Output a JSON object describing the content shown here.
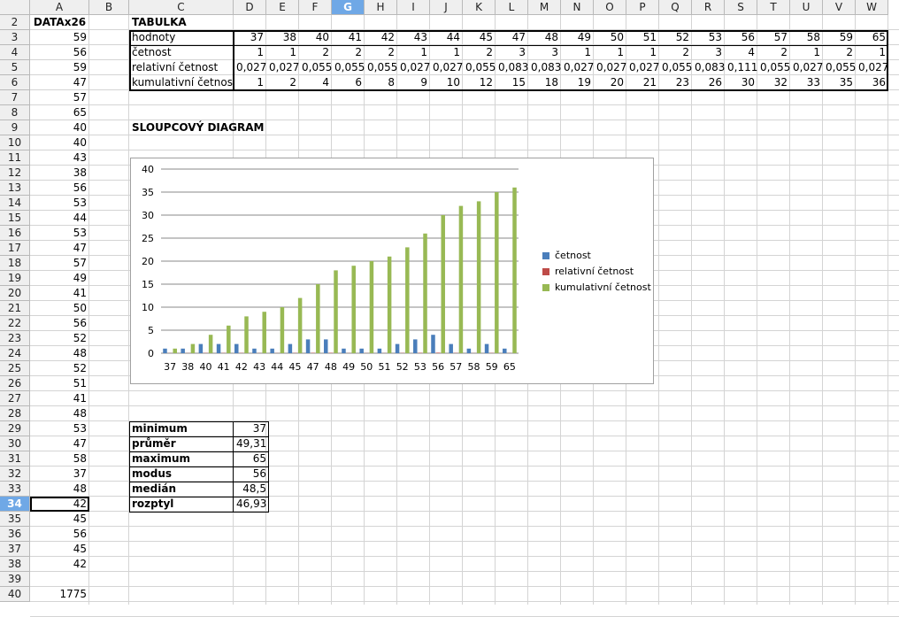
{
  "columns": [
    "A",
    "B",
    "C",
    "D",
    "E",
    "F",
    "G",
    "H",
    "I",
    "J",
    "K",
    "L",
    "M",
    "N",
    "O",
    "P",
    "Q",
    "R",
    "S",
    "T",
    "U",
    "V",
    "W"
  ],
  "selected_column": "G",
  "selected_row": 34,
  "rows": [
    2,
    3,
    4,
    5,
    6,
    7,
    8,
    9,
    10,
    11,
    12,
    13,
    14,
    15,
    16,
    17,
    18,
    19,
    20,
    21,
    22,
    23,
    24,
    25,
    26,
    27,
    28,
    29,
    30,
    31,
    32,
    33,
    34,
    35,
    36,
    37,
    38,
    39,
    40
  ],
  "colA": {
    "header": "DATAx26",
    "values": [
      "59",
      "56",
      "59",
      "47",
      "57",
      "65",
      "40",
      "40",
      "43",
      "38",
      "56",
      "53",
      "44",
      "53",
      "47",
      "57",
      "49",
      "41",
      "50",
      "56",
      "52",
      "48",
      "52",
      "51",
      "41",
      "48",
      "53",
      "47",
      "58",
      "37",
      "48",
      "42",
      "45",
      "56",
      "45",
      "42",
      "",
      "1775"
    ]
  },
  "tabulka": {
    "title": "TABULKA",
    "row_labels": [
      "hodnoty",
      "četnost",
      "relativní četnost",
      "kumulativní četnost"
    ],
    "hodnoty": [
      "37",
      "38",
      "40",
      "41",
      "42",
      "43",
      "44",
      "45",
      "47",
      "48",
      "49",
      "50",
      "51",
      "52",
      "53",
      "56",
      "57",
      "58",
      "59",
      "65"
    ],
    "cetnost": [
      "1",
      "1",
      "2",
      "2",
      "2",
      "1",
      "1",
      "2",
      "3",
      "3",
      "1",
      "1",
      "1",
      "2",
      "3",
      "4",
      "2",
      "1",
      "2",
      "1"
    ],
    "relativni": [
      "0,027",
      "0,027",
      "0,055",
      "0,055",
      "0,055",
      "0,027",
      "0,027",
      "0,055",
      "0,083",
      "0,083",
      "0,027",
      "0,027",
      "0,027",
      "0,055",
      "0,083",
      "0,111",
      "0,055",
      "0,027",
      "0,055",
      "0,027"
    ],
    "kumulativni": [
      "1",
      "2",
      "4",
      "6",
      "8",
      "9",
      "10",
      "12",
      "15",
      "18",
      "19",
      "20",
      "21",
      "23",
      "26",
      "30",
      "32",
      "33",
      "35",
      "36"
    ]
  },
  "diagram_title": "SLOUPCOVÝ DIAGRAM",
  "stats": {
    "labels": [
      "minimum",
      "průměr",
      "maximum",
      "modus",
      "medián",
      "rozptyl"
    ],
    "values": [
      "37",
      "49,31",
      "65",
      "56",
      "48,5",
      "46,93"
    ]
  },
  "chart_data": {
    "type": "bar",
    "categories": [
      "37",
      "38",
      "40",
      "41",
      "42",
      "43",
      "44",
      "45",
      "47",
      "48",
      "49",
      "50",
      "51",
      "52",
      "53",
      "56",
      "57",
      "58",
      "59",
      "65"
    ],
    "series": [
      {
        "name": "četnost",
        "color": "#4a7ebb",
        "values": [
          1,
          1,
          2,
          2,
          2,
          1,
          1,
          2,
          3,
          3,
          1,
          1,
          1,
          2,
          3,
          4,
          2,
          1,
          2,
          1
        ]
      },
      {
        "name": "relativní četnost",
        "color": "#be4b48",
        "values": [
          0.027,
          0.027,
          0.055,
          0.055,
          0.055,
          0.027,
          0.027,
          0.055,
          0.083,
          0.083,
          0.027,
          0.027,
          0.027,
          0.055,
          0.083,
          0.111,
          0.055,
          0.027,
          0.055,
          0.027
        ]
      },
      {
        "name": "kumulativní četnost",
        "color": "#98b954",
        "values": [
          1,
          2,
          4,
          6,
          8,
          9,
          10,
          12,
          15,
          18,
          19,
          20,
          21,
          23,
          26,
          30,
          32,
          33,
          35,
          36
        ]
      }
    ],
    "ylim": [
      0,
      40
    ],
    "yticks": [
      "0",
      "5",
      "10",
      "15",
      "20",
      "25",
      "30",
      "35",
      "40"
    ],
    "grid": true,
    "legend": "right"
  }
}
